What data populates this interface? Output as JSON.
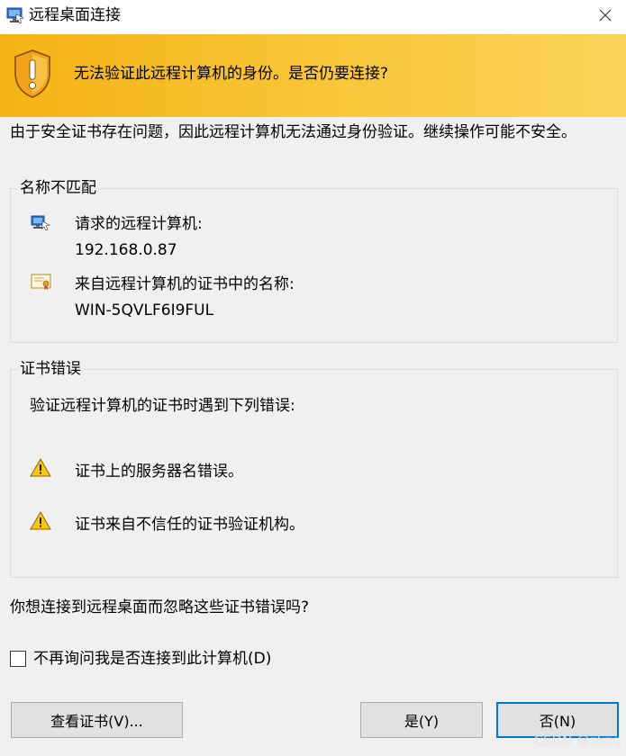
{
  "window": {
    "title": "远程桌面连接",
    "close_icon": "close-icon"
  },
  "banner": {
    "icon": "warning-shield-icon",
    "message": "无法验证此远程计算机的身份。是否仍要连接?",
    "color": "#f7bd2a"
  },
  "intro": "由于安全证书存在问题，因此远程计算机无法通过身份验证。继续操作可能不安全。",
  "name_mismatch": {
    "title": "名称不匹配",
    "requested_label": "请求的远程计算机:",
    "requested_value": "192.168.0.87",
    "cert_label": "来自远程计算机的证书中的名称:",
    "cert_value": "WIN-5QVLF6I9FUL"
  },
  "cert_errors": {
    "title": "证书错误",
    "description": "验证远程计算机的证书时遇到下列错误:",
    "errors": [
      "证书上的服务器名错误。",
      "证书来自不信任的证书验证机构。"
    ]
  },
  "question": "你想连接到远程桌面而忽略这些证书错误吗?",
  "checkbox": {
    "label": "不再询问我是否连接到此计算机(D)",
    "checked": false
  },
  "buttons": {
    "view_cert": "查看证书(V)...",
    "yes": "是(Y)",
    "no": "否(N)",
    "default_border_color": "#0078d7"
  },
  "watermark": "CSDN @zkzq"
}
